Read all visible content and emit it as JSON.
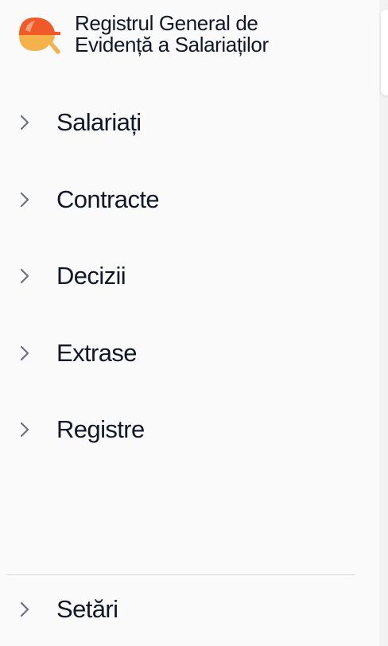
{
  "app": {
    "title": "Registrul General de Evidență a Salariaților",
    "logo_icon": "hardhat-search-icon",
    "colors": {
      "logo_orange": "#f05a28",
      "logo_yellow": "#f6b24a",
      "text": "#101828",
      "chevron": "#6b7280"
    }
  },
  "nav": {
    "items": [
      {
        "label": "Salariați",
        "icon": "chevron-right-icon"
      },
      {
        "label": "Contracte",
        "icon": "chevron-right-icon"
      },
      {
        "label": "Decizii",
        "icon": "chevron-right-icon"
      },
      {
        "label": "Extrase",
        "icon": "chevron-right-icon"
      },
      {
        "label": "Registre",
        "icon": "chevron-right-icon"
      }
    ]
  },
  "footer": {
    "settings_label": "Setări",
    "settings_icon": "chevron-right-icon"
  }
}
